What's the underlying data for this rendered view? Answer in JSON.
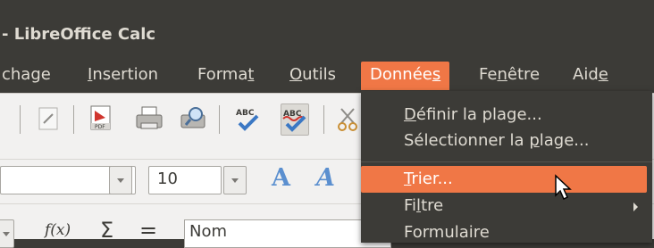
{
  "window": {
    "title": "- LibreOffice Calc"
  },
  "menubar": {
    "items": [
      {
        "id": "affichage",
        "pre": "",
        "u": "",
        "post": "chage"
      },
      {
        "id": "insertion",
        "pre": "",
        "u": "I",
        "post": "nsertion"
      },
      {
        "id": "format",
        "pre": "Forma",
        "u": "t",
        "post": ""
      },
      {
        "id": "outils",
        "pre": "",
        "u": "O",
        "post": "utils"
      },
      {
        "id": "donnees",
        "pre": "Donnée",
        "u": "s",
        "post": ""
      },
      {
        "id": "fenetre",
        "pre": "Fe",
        "u": "n",
        "post": "être"
      },
      {
        "id": "aide",
        "pre": "Aid",
        "u": "e",
        "post": ""
      }
    ]
  },
  "format_toolbar": {
    "font_size": "10"
  },
  "formula_bar": {
    "function_wizard": "f(x)",
    "sum": "Σ",
    "equals": "=",
    "name": "Nom"
  },
  "donnees_menu": {
    "items": [
      {
        "pre": "",
        "u": "D",
        "post": "éfinir la plage..."
      },
      {
        "pre": "Sélectionner la ",
        "u": "p",
        "post": "lage..."
      },
      {
        "pre": "",
        "u": "T",
        "post": "rier..."
      },
      {
        "pre": "Fi",
        "u": "l",
        "post": "tre"
      },
      {
        "pre": "Formulaire",
        "u": "",
        "post": ""
      }
    ]
  },
  "colors": {
    "accent": "#f07746",
    "menubar_bg": "#3c3b37",
    "menubar_text": "#dfdbd2",
    "toolbar_bg": "#f2f1f0"
  },
  "icons": [
    "edit-file-icon",
    "export-pdf-icon",
    "print-icon",
    "print-preview-icon",
    "spellcheck-icon",
    "auto-spellcheck-icon",
    "cut-icon",
    "font-grow-icon",
    "font-italic-icon",
    "submenu-arrow-icon",
    "mouse-cursor-icon"
  ]
}
